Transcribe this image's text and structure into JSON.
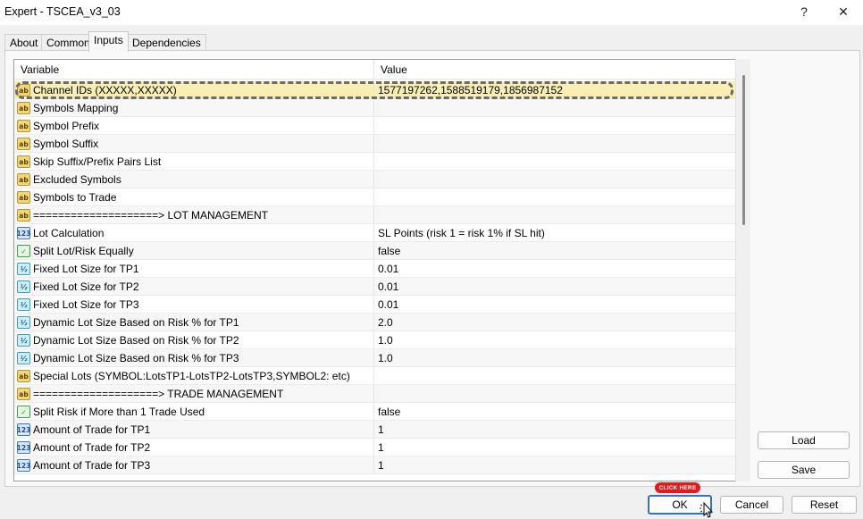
{
  "window": {
    "title": "Expert - TSCEA_v3_03",
    "help": "?",
    "close": "✕"
  },
  "tabs": [
    "About",
    "Common",
    "Inputs",
    "Dependencies"
  ],
  "table": {
    "headers": {
      "variable": "Variable",
      "value": "Value"
    },
    "rows": [
      {
        "icon": "ab",
        "name": "Channel IDs (XXXXX,XXXXX)",
        "value": "1577197262,1588519179,1856987152"
      },
      {
        "icon": "ab",
        "name": "Symbols Mapping",
        "value": ""
      },
      {
        "icon": "ab",
        "name": "Symbol Prefix",
        "value": ""
      },
      {
        "icon": "ab",
        "name": "Symbol Suffix",
        "value": ""
      },
      {
        "icon": "ab",
        "name": "Skip Suffix/Prefix Pairs List",
        "value": ""
      },
      {
        "icon": "ab",
        "name": "Excluded Symbols",
        "value": ""
      },
      {
        "icon": "ab",
        "name": "Symbols to Trade",
        "value": ""
      },
      {
        "icon": "ab",
        "name": "====================> LOT MANAGEMENT",
        "value": ""
      },
      {
        "icon": "123",
        "name": "Lot Calculation",
        "value": "SL Points (risk 1 = risk 1% if SL hit)"
      },
      {
        "icon": "bool",
        "name": "Split Lot/Risk Equally",
        "value": "false"
      },
      {
        "icon": "v2",
        "name": "Fixed Lot Size for TP1",
        "value": "0.01"
      },
      {
        "icon": "v2",
        "name": "Fixed Lot Size for TP2",
        "value": "0.01"
      },
      {
        "icon": "v2",
        "name": "Fixed Lot Size for TP3",
        "value": "0.01"
      },
      {
        "icon": "v2",
        "name": "Dynamic Lot Size Based on Risk % for TP1",
        "value": "2.0"
      },
      {
        "icon": "v2",
        "name": "Dynamic Lot Size Based on Risk % for TP2",
        "value": "1.0"
      },
      {
        "icon": "v2",
        "name": "Dynamic Lot Size Based on Risk % for TP3",
        "value": "1.0"
      },
      {
        "icon": "ab",
        "name": "Special Lots (SYMBOL:LotsTP1-LotsTP2-LotsTP3,SYMBOL2: etc)",
        "value": ""
      },
      {
        "icon": "ab",
        "name": "====================> TRADE MANAGEMENT",
        "value": ""
      },
      {
        "icon": "bool",
        "name": "Split Risk if More than 1 Trade Used",
        "value": "false"
      },
      {
        "icon": "123",
        "name": "Amount of Trade for TP1",
        "value": "1"
      },
      {
        "icon": "123",
        "name": "Amount of Trade for TP2",
        "value": "1"
      },
      {
        "icon": "123",
        "name": "Amount of Trade for TP3",
        "value": "1"
      }
    ],
    "icon_glyphs": {
      "ab": "ab",
      "123": "123",
      "v2": "½",
      "bool": "✓"
    }
  },
  "side_buttons": {
    "load": "Load",
    "save": "Save"
  },
  "bottom_buttons": {
    "ok": "OK",
    "cancel": "Cancel",
    "reset": "Reset"
  },
  "callout": "CLICK HERE",
  "colors": {
    "selected_row": "#faeeb2",
    "ok_border": "#3272c8",
    "callout_bg": "#e01b1b"
  }
}
